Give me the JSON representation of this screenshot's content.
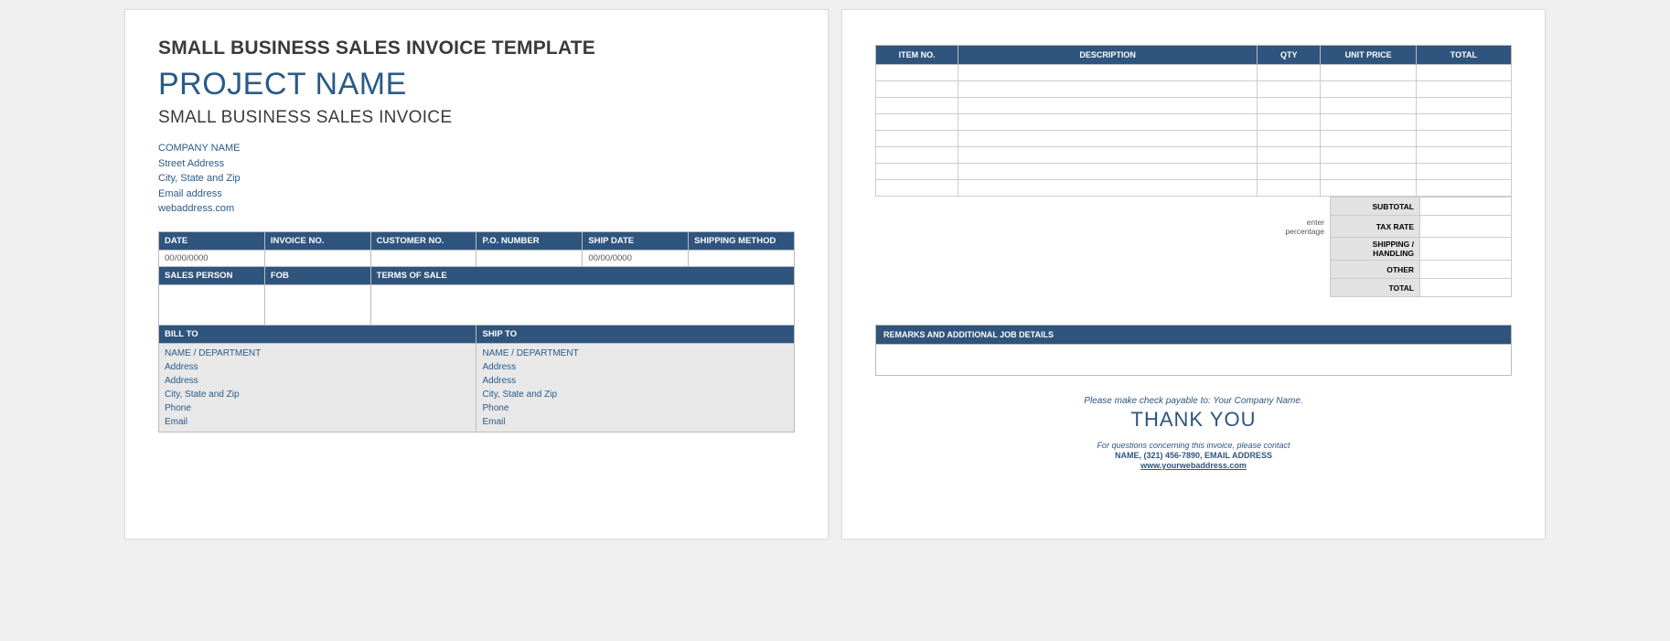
{
  "page1": {
    "title": "SMALL BUSINESS SALES INVOICE TEMPLATE",
    "project_name": "PROJECT NAME",
    "subtitle": "SMALL BUSINESS SALES INVOICE",
    "company": {
      "name": "COMPANY NAME",
      "street": "Street Address",
      "city": "City, State and Zip",
      "email": "Email address",
      "web": "webaddress.com"
    },
    "info_headers": [
      "DATE",
      "INVOICE NO.",
      "CUSTOMER NO.",
      "P.O. NUMBER",
      "SHIP DATE",
      "SHIPPING METHOD"
    ],
    "info_values": [
      "00/00/0000",
      "",
      "",
      "",
      "00/00/0000",
      ""
    ],
    "sales_headers": [
      "SALES PERSON",
      "FOB",
      "TERMS OF SALE"
    ],
    "bill_to_label": "BILL TO",
    "ship_to_label": "SHIP TO",
    "bill_to": [
      "NAME / DEPARTMENT",
      "Address",
      "Address",
      "City, State and Zip",
      "Phone",
      "Email"
    ],
    "ship_to": [
      "NAME / DEPARTMENT",
      "Address",
      "Address",
      "City, State and Zip",
      "Phone",
      "Email"
    ]
  },
  "page2": {
    "item_headers": [
      "ITEM NO.",
      "DESCRIPTION",
      "QTY",
      "UNIT PRICE",
      "TOTAL"
    ],
    "blank_rows": 8,
    "totals": {
      "subtotal": "SUBTOTAL",
      "tax_rate": "TAX RATE",
      "tax_note1": "enter",
      "tax_note2": "percentage",
      "shipping": "SHIPPING / HANDLING",
      "other": "OTHER",
      "total": "TOTAL"
    },
    "remarks_header": "REMARKS AND ADDITIONAL JOB DETAILS",
    "footer": {
      "payto_pre": "Please make check payable to: ",
      "payto_name": "Your Company Name.",
      "thank": "THANK YOU",
      "q": "For questions concerning this invoice, please contact",
      "contact": "NAME, (321) 456-7890, EMAIL ADDRESS",
      "web": "www.yourwebaddress.com"
    }
  }
}
